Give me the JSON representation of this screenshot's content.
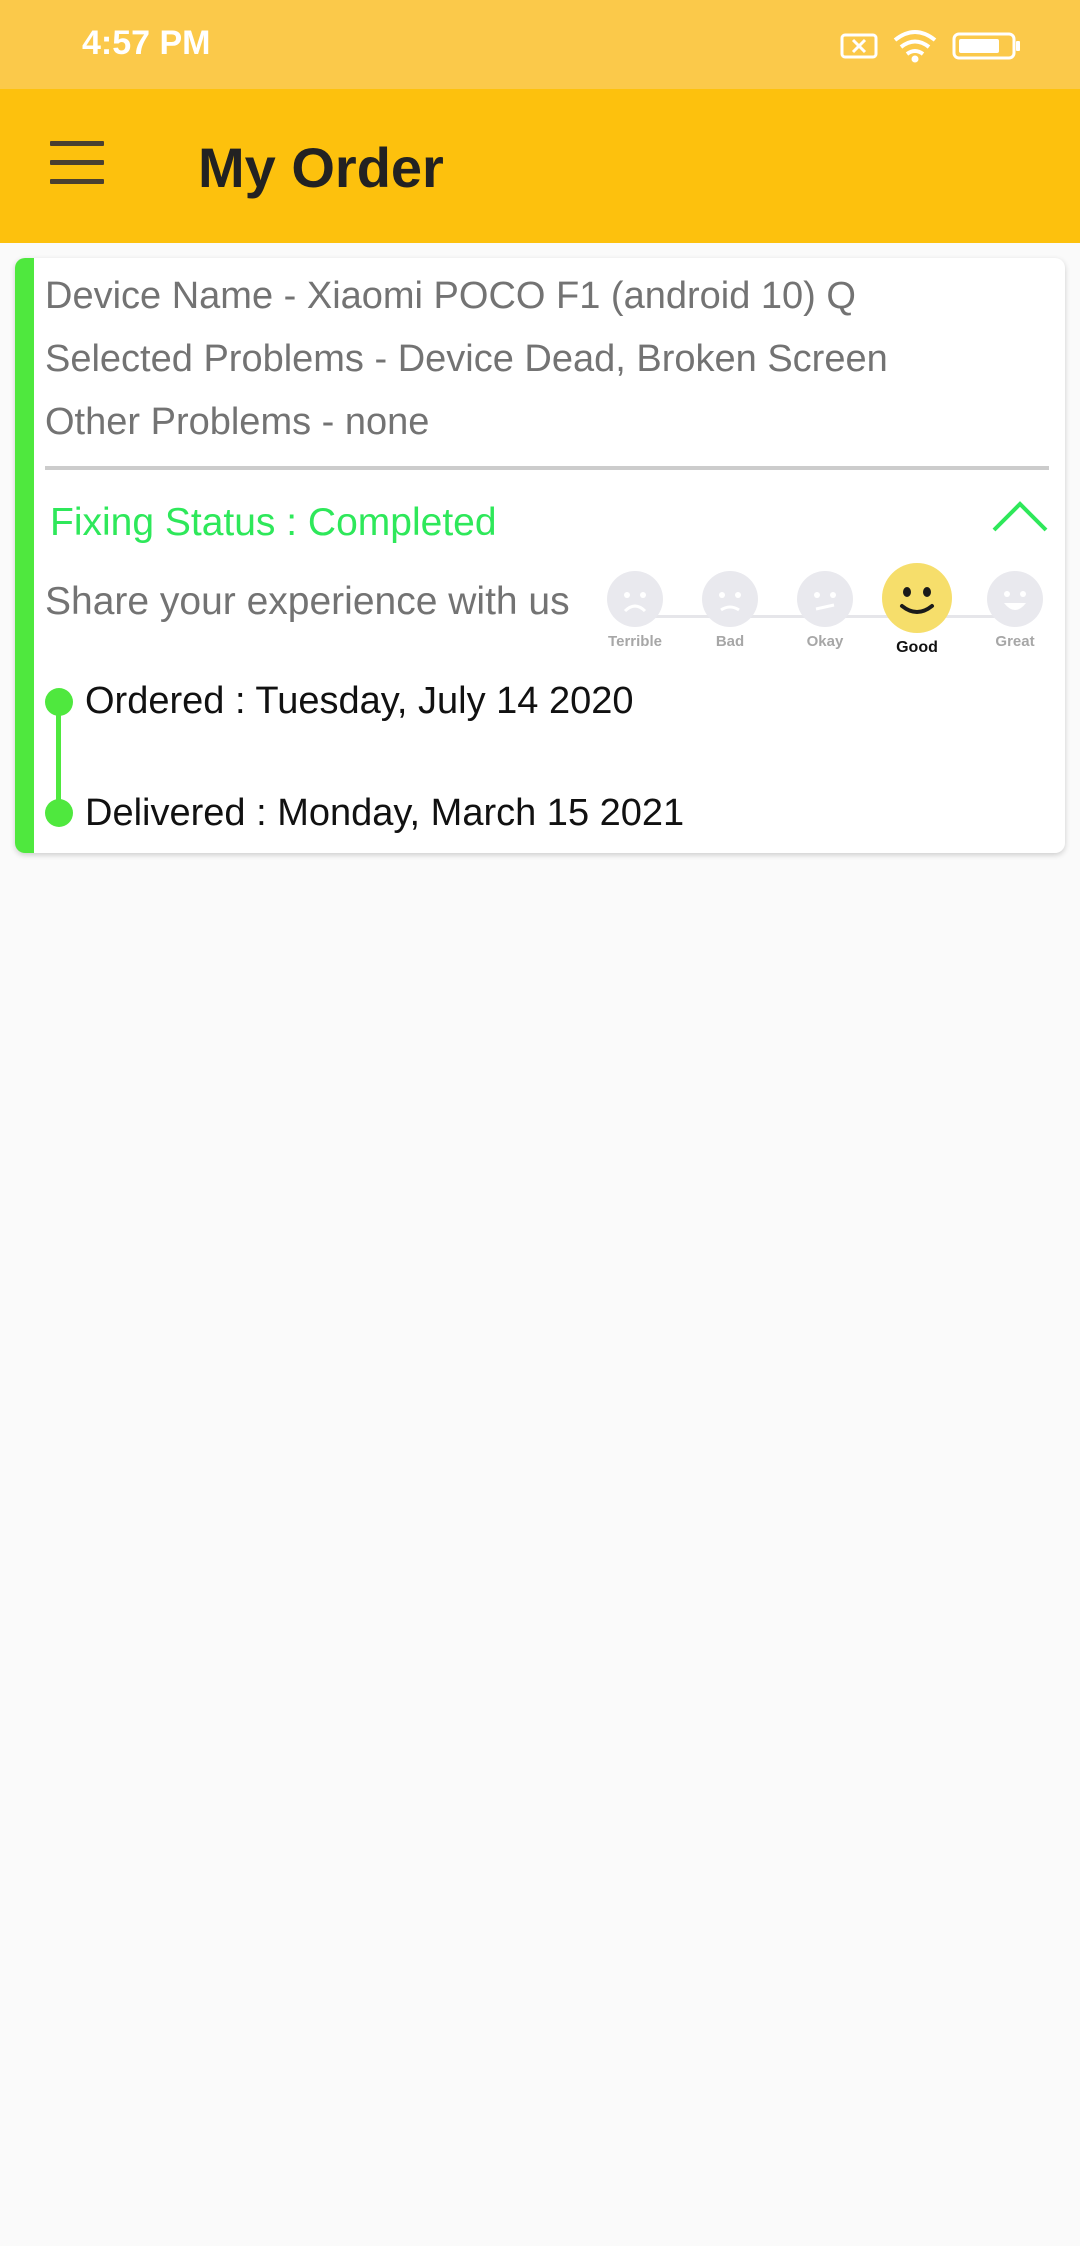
{
  "status_bar": {
    "time": "4:57 PM",
    "icons": [
      "sim-blocked-icon",
      "wifi-icon",
      "battery-icon"
    ]
  },
  "app_bar": {
    "menu_icon": "hamburger-menu-icon",
    "title": "My Order",
    "background": "#fdc10d"
  },
  "order": {
    "device_name": "Device Name - Xiaomi POCO F1 (android 10) Q",
    "selected_problems": "Selected Problems - Device Dead, Broken Screen",
    "other_problems": "Other Problems - none",
    "fixing_status": "Fixing Status : Completed",
    "status_color": "#2ee85a",
    "collapse_icon": "chevron-up-icon",
    "share_label": "Share your experience with us",
    "rating": {
      "options": [
        "Terrible",
        "Bad",
        "Okay",
        "Good",
        "Great"
      ],
      "selected": "Good"
    },
    "timeline": {
      "ordered": "Ordered : Tuesday, July 14 2020",
      "delivered": "Delivered : Monday, March 15 2021",
      "color": "#4fe83e"
    }
  }
}
